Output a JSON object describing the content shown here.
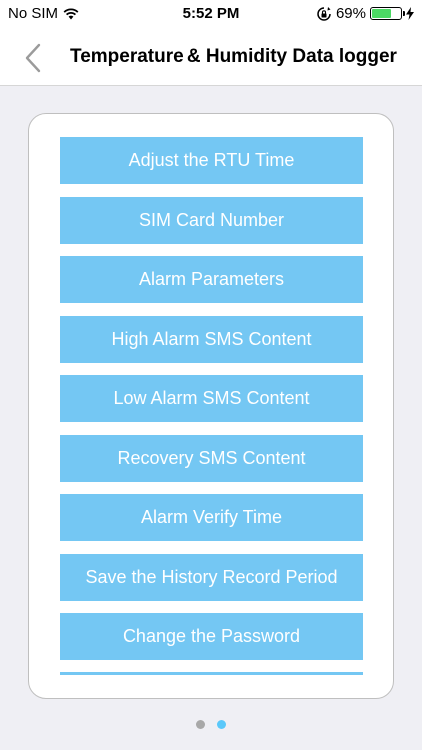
{
  "status_bar": {
    "carrier": "No SIM",
    "time": "5:52 PM",
    "battery_percent": "69%",
    "battery_level": 0.69,
    "icons": [
      "wifi-icon",
      "rotation-lock-icon",
      "battery-icon",
      "charging-bolt-icon"
    ]
  },
  "nav": {
    "title": "Temperature & Humidity Data logger",
    "back_icon": "chevron-left-icon"
  },
  "menu": {
    "items": [
      {
        "label": "Adjust the RTU Time"
      },
      {
        "label": "SIM Card Number"
      },
      {
        "label": "Alarm Parameters"
      },
      {
        "label": "High Alarm SMS Content"
      },
      {
        "label": "Low Alarm SMS Content"
      },
      {
        "label": "Recovery SMS Content"
      },
      {
        "label": "Alarm Verify Time"
      },
      {
        "label": "Save the History Record Period"
      },
      {
        "label": "Change the Password"
      }
    ]
  },
  "pager": {
    "page_count": 2,
    "current_page": 2
  },
  "colors": {
    "button_bg": "#74c7f3",
    "button_text": "#ffffff",
    "background": "#efeff4",
    "active_dot": "#5ac8fa",
    "inactive_dot": "#a8a8a8",
    "battery_fill": "#4cd964"
  }
}
